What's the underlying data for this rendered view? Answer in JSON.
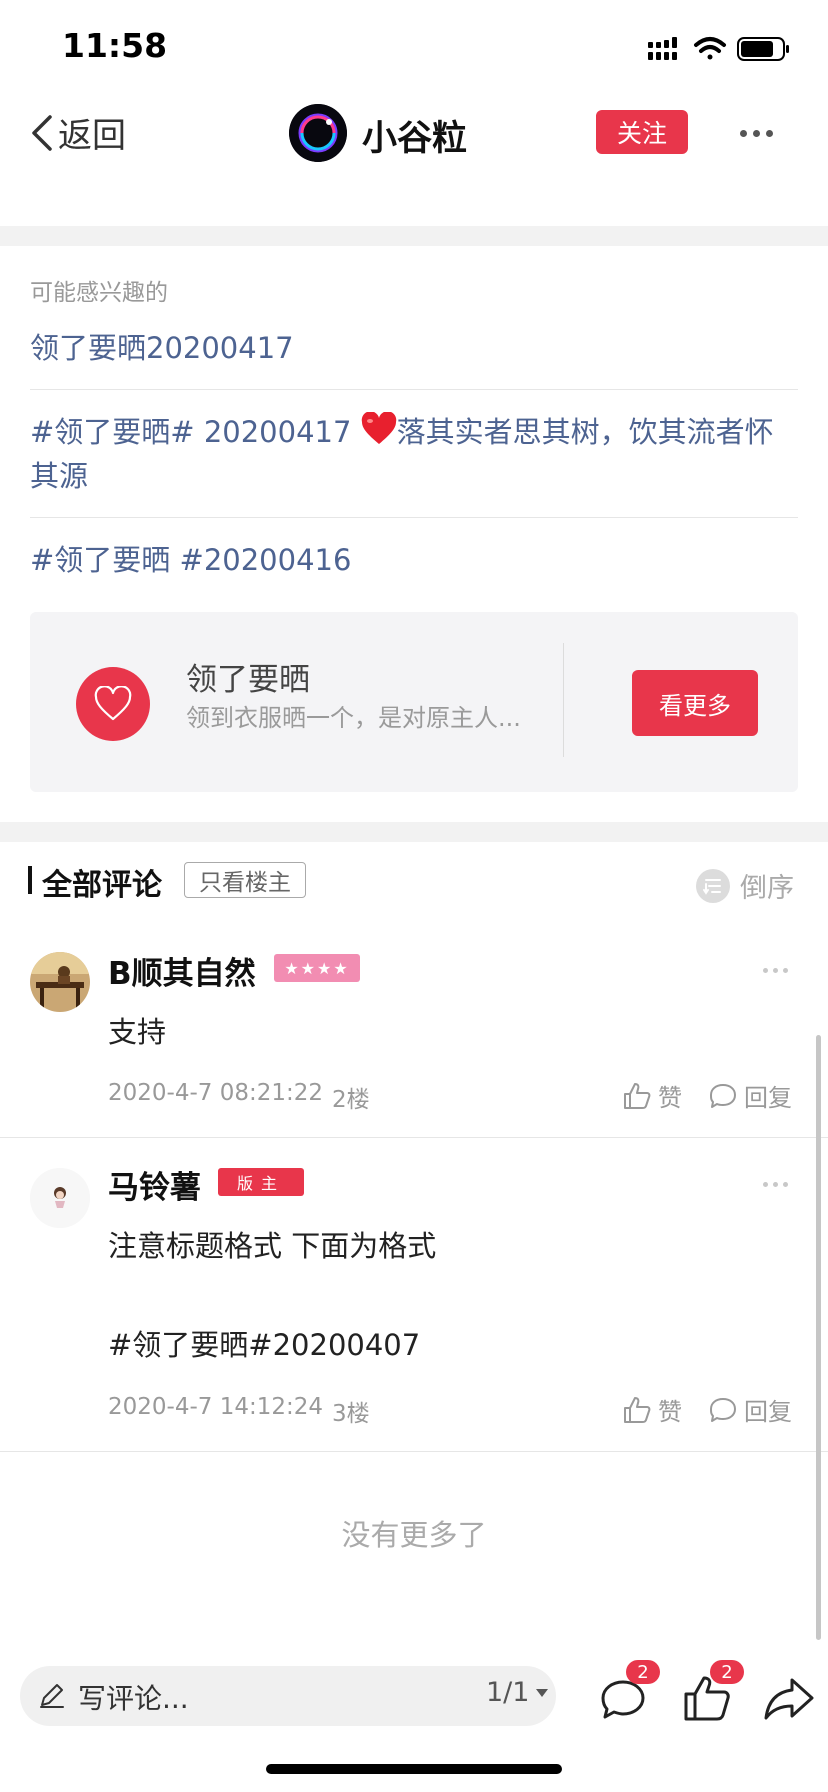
{
  "status_bar": {
    "time": "11:58"
  },
  "nav": {
    "back_label": "返回",
    "title": "小谷粒",
    "follow_label": "关注"
  },
  "interest": {
    "title": "可能感兴趣的",
    "topics": [
      {
        "text": "领了要晒20200417"
      },
      {
        "before": "#领了要晒# 20200417 ",
        "after": "落其实者思其树，饮其流者怀其源"
      },
      {
        "text": "#领了要晒 #20200416"
      }
    ],
    "card": {
      "title": "领了要晒",
      "subtitle": "领到衣服晒一个，是对原主人...",
      "button": "看更多"
    }
  },
  "comments_header": {
    "title": "全部评论",
    "only_op": "只看楼主",
    "order": "倒序"
  },
  "comments": [
    {
      "name": "B顺其自然",
      "badge": "★★★★",
      "text1": "支持",
      "time": "2020-4-7 08:21:22",
      "floor": "2楼",
      "like": "赞",
      "reply": "回复"
    },
    {
      "name": "马铃薯",
      "badge": "版主",
      "text1": "注意标题格式 下面为格式",
      "text2": "#领了要晒#20200407",
      "time": "2020-4-7 14:12:24",
      "floor": "3楼",
      "like": "赞",
      "reply": "回复"
    }
  ],
  "no_more": "没有更多了",
  "bottom_bar": {
    "write_placeholder": "写评论...",
    "page": "1/1",
    "comment_count": "2",
    "like_count": "2"
  },
  "colors": {
    "accent": "#e8364b",
    "link": "#4d6391",
    "badge_pink": "#f28db2"
  }
}
